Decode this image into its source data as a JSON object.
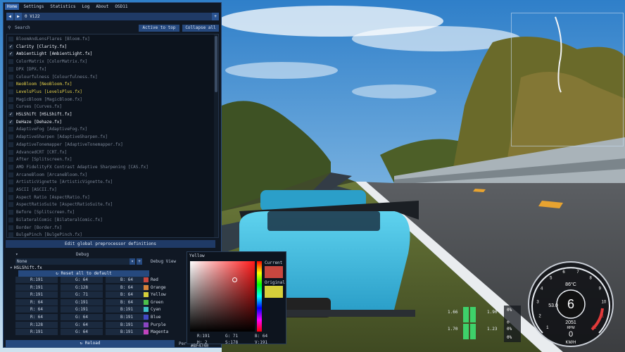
{
  "menu": {
    "tabs": [
      "Home",
      "Settings",
      "Statistics",
      "Log",
      "About",
      "OSD11"
    ],
    "active": 0
  },
  "preset": {
    "prev": "◀",
    "next": "▶",
    "name": "0 Vi22",
    "add": "+"
  },
  "search": {
    "placeholder": "Search",
    "active_to_top": "Active to top",
    "collapse_all": "Collapse all"
  },
  "effects": [
    {
      "label": "BloomAndLensFlares [Bloom.fx]",
      "checked": false,
      "style": "off"
    },
    {
      "label": "Clarity [Clarity.fx]",
      "checked": true,
      "style": "on"
    },
    {
      "label": "AmbientLight [AmbientLight.fx]",
      "checked": true,
      "style": "on"
    },
    {
      "label": "ColorMatrix [ColorMatrix.fx]",
      "checked": false,
      "style": "off"
    },
    {
      "label": "DPX [DPX.fx]",
      "checked": false,
      "style": "off"
    },
    {
      "label": "Colourfulness [Colourfulness.fx]",
      "checked": false,
      "style": "off"
    },
    {
      "label": "NeoBloom [NeoBloom.fx]",
      "checked": false,
      "style": "yellow"
    },
    {
      "label": "LevelsPlus [LevelsPlus.fx]",
      "checked": false,
      "style": "yellow"
    },
    {
      "label": "MagicBloom [MagicBloom.fx]",
      "checked": false,
      "style": "off"
    },
    {
      "label": "Curves [Curves.fx]",
      "checked": false,
      "style": "off"
    },
    {
      "label": "HSLShift [HSLShift.fx]",
      "checked": true,
      "style": "on"
    },
    {
      "label": "DeHaze [Dehaze.fx]",
      "checked": true,
      "style": "on"
    },
    {
      "label": "AdaptiveFog [AdaptiveFog.fx]",
      "checked": false,
      "style": "off"
    },
    {
      "label": "AdaptiveSharpen [AdaptiveSharpen.fx]",
      "checked": false,
      "style": "off"
    },
    {
      "label": "AdaptiveTonemapper [AdaptiveTonemapper.fx]",
      "checked": false,
      "style": "off"
    },
    {
      "label": "AdvancedCRT [CRT.fx]",
      "checked": false,
      "style": "off"
    },
    {
      "label": "After [Splitscreen.fx]",
      "checked": false,
      "style": "off"
    },
    {
      "label": "AMD FidelityFX Contrast Adaptive Sharpening [CAS.fx]",
      "checked": false,
      "style": "off"
    },
    {
      "label": "ArcaneBloom [ArcaneBloom.fx]",
      "checked": false,
      "style": "off"
    },
    {
      "label": "ArtisticVignette [ArtisticVignette.fx]",
      "checked": false,
      "style": "off"
    },
    {
      "label": "ASCII [ASCII.fx]",
      "checked": false,
      "style": "off"
    },
    {
      "label": "Aspect Ratio [AspectRatio.fx]",
      "checked": false,
      "style": "off"
    },
    {
      "label": "AspectRatioSuite [AspectRatioSuite.fx]",
      "checked": false,
      "style": "off"
    },
    {
      "label": "Before [Splitscreen.fx]",
      "checked": false,
      "style": "off"
    },
    {
      "label": "BilateralComic [BilateralComic.fx]",
      "checked": false,
      "style": "off"
    },
    {
      "label": "Border [Border.fx]",
      "checked": false,
      "style": "off"
    },
    {
      "label": "BulgePinch [BulgePinch.fx]",
      "checked": false,
      "style": "off"
    }
  ],
  "global_pp": {
    "label": "Edit global preprocessor definitions"
  },
  "debug": {
    "label": "Debug",
    "view_value": "None",
    "view_label": "Debug View"
  },
  "hslshift": {
    "title": "HSLShift.fx",
    "reset": "Reset all to default"
  },
  "hsl_rows": [
    {
      "r": "R:191",
      "g": "G: 64",
      "b": "B: 64",
      "name": "Red",
      "color": "#c8473f"
    },
    {
      "r": "R:191",
      "g": "G:128",
      "b": "B: 64",
      "name": "Orange",
      "color": "#d8833a"
    },
    {
      "r": "R:191",
      "g": "G: 71",
      "b": "B: 64",
      "name": "Yellow",
      "color": "#d6cf3a"
    },
    {
      "r": "R: 64",
      "g": "G:191",
      "b": "B: 64",
      "name": "Green",
      "color": "#4cbf49"
    },
    {
      "r": "R: 64",
      "g": "G:191",
      "b": "B:191",
      "name": "Cyan",
      "color": "#3fc0c6"
    },
    {
      "r": "R: 64",
      "g": "G: 64",
      "b": "B:191",
      "name": "Blue",
      "color": "#4249c4"
    },
    {
      "r": "R:128",
      "g": "G: 64",
      "b": "B:191",
      "name": "Purple",
      "color": "#8a45c2"
    },
    {
      "r": "R:191",
      "g": "G: 64",
      "b": "B:191",
      "name": "Magenta",
      "color": "#c043bd"
    }
  ],
  "reload": {
    "label": "Reload",
    "extra": "Per"
  },
  "picker": {
    "title": "Yellow",
    "current_label": "Current",
    "original_label": "Original",
    "r": "R:191",
    "g": "G: 71",
    "b": "B: 64",
    "h": "H: 2",
    "s": "S:178",
    "v": "V:191",
    "hex": "#BF4740"
  },
  "hud": {
    "temp": "86°C",
    "gear": "6",
    "speed": "53.0",
    "rpm": "2051",
    "rpm_label": "RPM",
    "kmh": "0",
    "kmh_label": "KM/H",
    "pct_a": "0%",
    "pct_b": "0%",
    "pct_c": "0%",
    "ticks": [
      "1",
      "2",
      "3",
      "4",
      "5",
      "6",
      "7",
      "8",
      "9",
      "10",
      "11",
      "12"
    ],
    "bar_a": "1.66",
    "bar_b": "1.90",
    "bar_c": "1.70",
    "bar_d": "1.23"
  }
}
